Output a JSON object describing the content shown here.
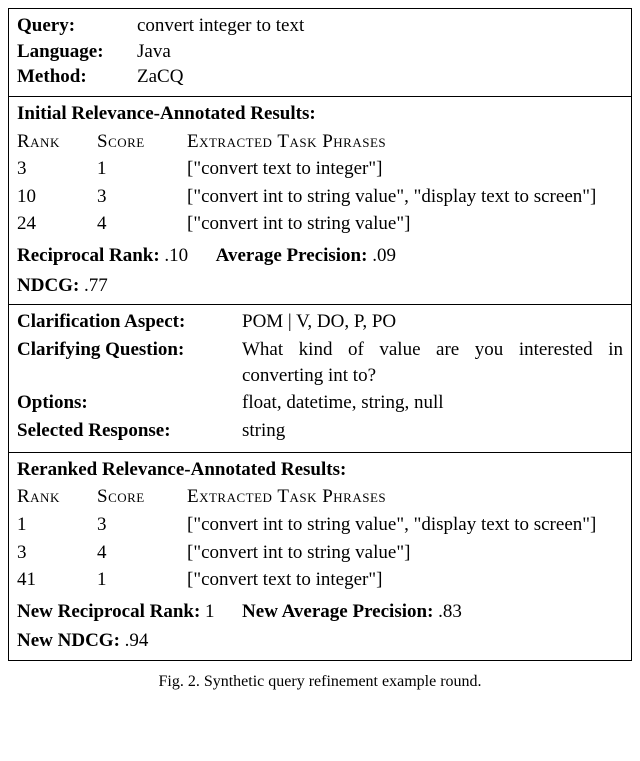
{
  "header": {
    "query_label": "Query:",
    "query_value": "convert integer to text",
    "language_label": "Language:",
    "language_value": "Java",
    "method_label": "Method:",
    "method_value": "ZaCQ"
  },
  "initial": {
    "title": "Initial Relevance-Annotated Results:",
    "cols": {
      "rank": "Rank",
      "score": "Score",
      "phrases": "Extracted Task Phrases"
    },
    "rows": [
      {
        "rank": "3",
        "score": "1",
        "phrases": "[\"convert text to integer\"]"
      },
      {
        "rank": "10",
        "score": "3",
        "phrases": "[\"convert int to string value\", \"display text to screen\"]"
      },
      {
        "rank": "24",
        "score": "4",
        "phrases": "[\"convert int to string value\"]"
      }
    ],
    "rr_label": "Reciprocal Rank:",
    "rr": ".10",
    "ap_label": "Average Precision:",
    "ap": ".09",
    "ndcg_label": "NDCG:",
    "ndcg": ".77"
  },
  "clarify": {
    "aspect_label": "Clarification Aspect:",
    "aspect_value": "POM | V, DO, P, PO",
    "question_label": "Clarifying Question:",
    "question_value": "What kind of value are you interested in converting int to?",
    "options_label": "Options:",
    "options_value": "float, datetime, string, null",
    "selected_label": "Selected Response:",
    "selected_value": "string"
  },
  "reranked": {
    "title": "Reranked Relevance-Annotated Results:",
    "cols": {
      "rank": "Rank",
      "score": "Score",
      "phrases": "Extracted Task Phrases"
    },
    "rows": [
      {
        "rank": "1",
        "score": "3",
        "phrases": "[\"convert int to string value\", \"display text to screen\"]"
      },
      {
        "rank": "3",
        "score": "4",
        "phrases": "[\"convert int to string value\"]"
      },
      {
        "rank": "41",
        "score": "1",
        "phrases": "[\"convert text to integer\"]"
      }
    ],
    "rr_label": "New Reciprocal Rank:",
    "rr": "1",
    "ap_label": "New Average Precision:",
    "ap": ".83",
    "ndcg_label": "New NDCG:",
    "ndcg": ".94"
  },
  "caption": "Fig. 2.  Synthetic query refinement example round."
}
